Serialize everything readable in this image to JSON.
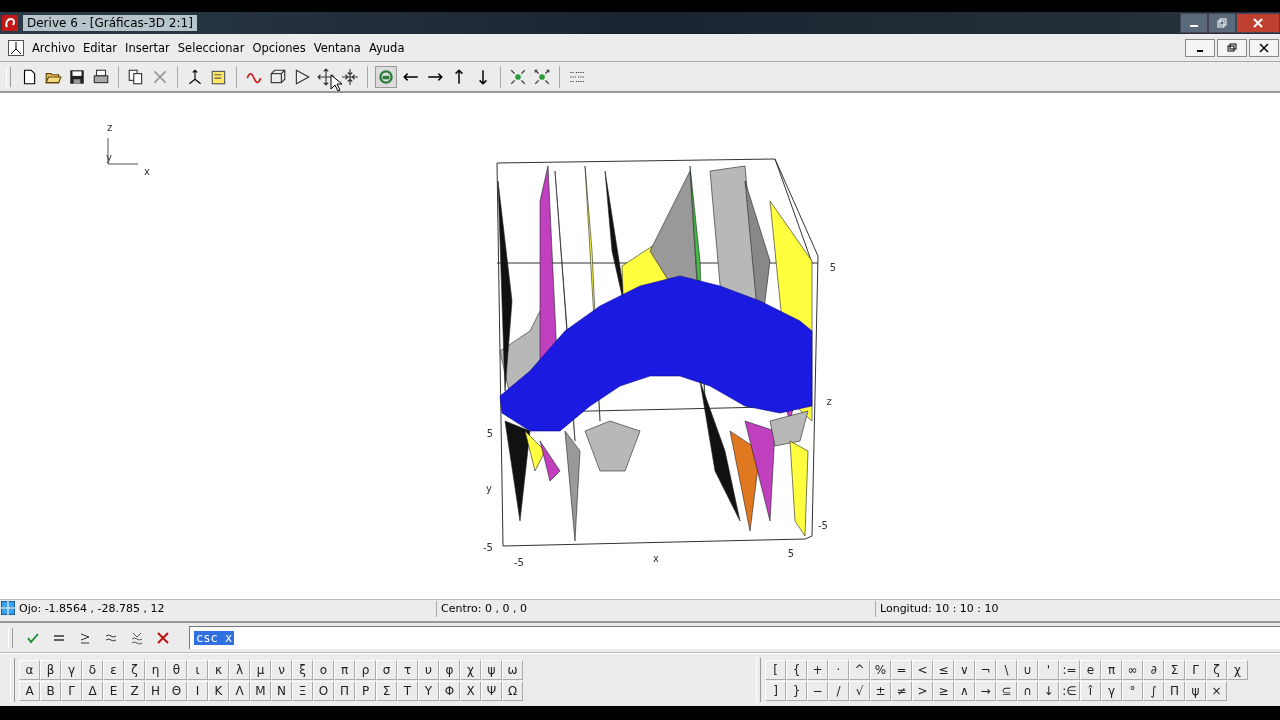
{
  "window": {
    "title": "Derive 6 - [Gráficas-3D 2:1]"
  },
  "menu": [
    "Archivo",
    "Editar",
    "Insertar",
    "Seleccionar",
    "Opciones",
    "Ventana",
    "Ayuda"
  ],
  "plot": {
    "mini_axes": [
      "z",
      "y",
      "x"
    ],
    "tick_labels": [
      "5",
      "z",
      "5",
      "y",
      "-5",
      "-5",
      "x",
      "5",
      "-5"
    ]
  },
  "status_bar": [
    "Ojo: -1.8564 , -28.785 , 12",
    "Centro: 0 , 0 , 0",
    "Longitud: 10 : 10 : 10"
  ],
  "expression": {
    "value": "csc x",
    "selected": true
  },
  "symbols": {
    "greek_lower": [
      "α",
      "β",
      "γ",
      "δ",
      "ε",
      "ζ",
      "η",
      "θ",
      "ι",
      "κ",
      "λ",
      "μ",
      "ν",
      "ξ",
      "ο",
      "π",
      "ρ",
      "σ",
      "τ",
      "υ",
      "φ",
      "χ",
      "ψ",
      "ω"
    ],
    "greek_upper": [
      "Α",
      "Β",
      "Γ",
      "Δ",
      "Ε",
      "Ζ",
      "Η",
      "Θ",
      "Ι",
      "Κ",
      "Λ",
      "Μ",
      "Ν",
      "Ξ",
      "Ο",
      "Π",
      "Ρ",
      "Σ",
      "Τ",
      "Υ",
      "Φ",
      "Χ",
      "Ψ",
      "Ω"
    ],
    "math_row_1": [
      "[",
      "{",
      "+",
      "·",
      "^",
      "%",
      "=",
      "<",
      "≤",
      "∨",
      "¬",
      "\\",
      "∪",
      "'",
      ":=",
      "e",
      "π",
      "∞",
      "∂",
      "Σ",
      "Γ",
      "ζ",
      "χ"
    ],
    "math_row_2": [
      "]",
      "}",
      "−",
      "/",
      "√",
      "±",
      "≠",
      ">",
      "≥",
      "∧",
      "→",
      "⊆",
      "∩",
      "↓",
      ":∈",
      "î",
      "γ",
      "°",
      "∫",
      "Π",
      "ψ",
      "×"
    ]
  }
}
